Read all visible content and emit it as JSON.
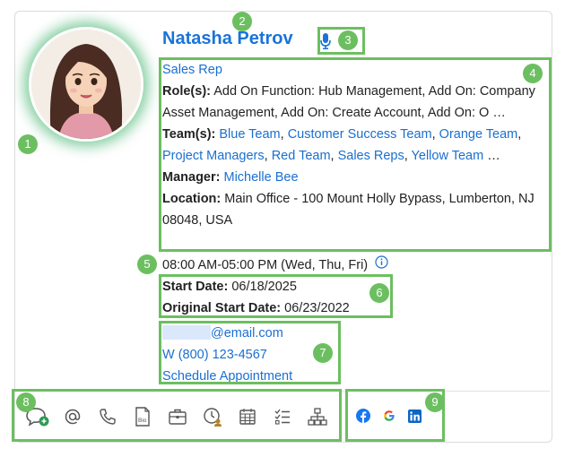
{
  "profile": {
    "name": "Natasha Petrov",
    "job_title": "Sales Rep",
    "roles_label": "Role(s):",
    "roles_text": "Add On Function: Hub Management, Add On: Company Asset Management, Add On: Create Account, Add On: O …",
    "teams_label": "Team(s):",
    "teams": [
      "Blue Team",
      "Customer Success Team",
      "Orange Team",
      "Project Managers",
      "Red Team",
      "Sales Reps",
      "Yellow Team"
    ],
    "teams_more": "…",
    "manager_label": "Manager:",
    "manager": "Michelle Bee",
    "location_label": "Location:",
    "location": "Main Office - 100 Mount Holly Bypass, Lumberton, NJ 08048, USA",
    "hours": "08:00 AM-05:00 PM (Wed, Thu, Fri)",
    "start_date_label": "Start Date:",
    "start_date": "06/18/2025",
    "original_start_label": "Original Start Date:",
    "original_start": "06/23/2022",
    "email_suffix": "@email.com",
    "phone": "W (800) 123-4567",
    "schedule": "Schedule Appointment"
  },
  "badges": [
    "1",
    "2",
    "3",
    "4",
    "5",
    "6",
    "7",
    "8",
    "9"
  ],
  "actions": [
    "chat-icon",
    "at-icon",
    "phone-icon",
    "bio-icon",
    "briefcase-icon",
    "time-user-icon",
    "calendar-icon",
    "checklist-icon",
    "org-chart-icon"
  ],
  "actions_bio_text": "Bio",
  "social": [
    "facebook-icon",
    "google-icon",
    "linkedin-icon"
  ],
  "colors": {
    "link": "#1a6fd1",
    "highlight": "#6cbf60",
    "avatar_glow": "#28aa5a"
  }
}
